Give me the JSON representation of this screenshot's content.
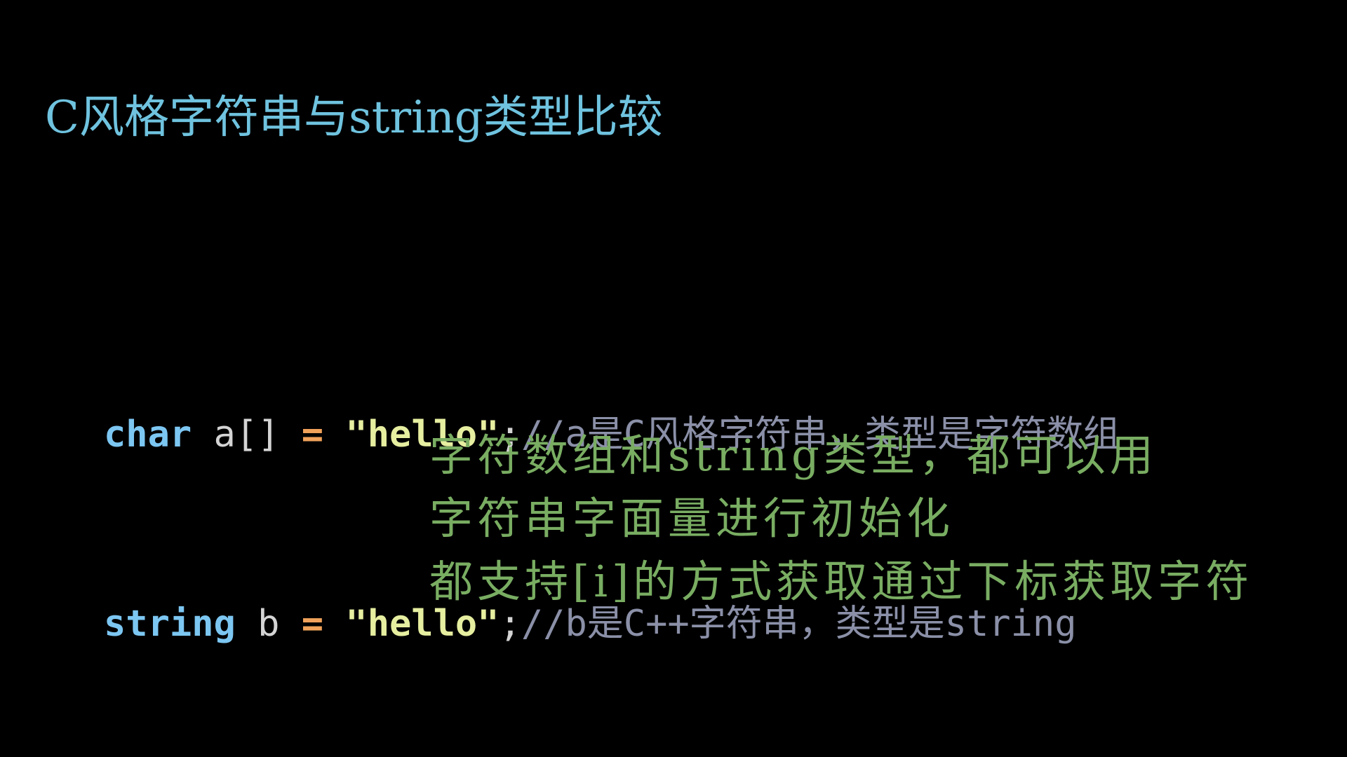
{
  "colors": {
    "background": "#000000",
    "title": "#6fc3df",
    "keyword": "#7cc6f2",
    "identifier": "#d4d4d4",
    "operator": "#f0a25a",
    "string": "#e6eea0",
    "comment": "#8b90a8",
    "note": "#79ad62"
  },
  "title": "C风格字符串与string类型比较",
  "code": {
    "line1": {
      "keyword": "char",
      "identifier": " a[] ",
      "operator": "=",
      "string": " \"hello\"",
      "punct": ";",
      "comment": "//a是C风格字符串，类型是字符数组"
    },
    "line2": {
      "keyword": "string",
      "identifier": " b ",
      "operator": "=",
      "string": " \"hello\"",
      "punct": ";",
      "comment": "//b是C++字符串，类型是string"
    }
  },
  "notes": [
    "字符数组和string类型，都可以用",
    "字符串字面量进行初始化",
    "都支持[i]的方式获取通过下标获取字符"
  ]
}
